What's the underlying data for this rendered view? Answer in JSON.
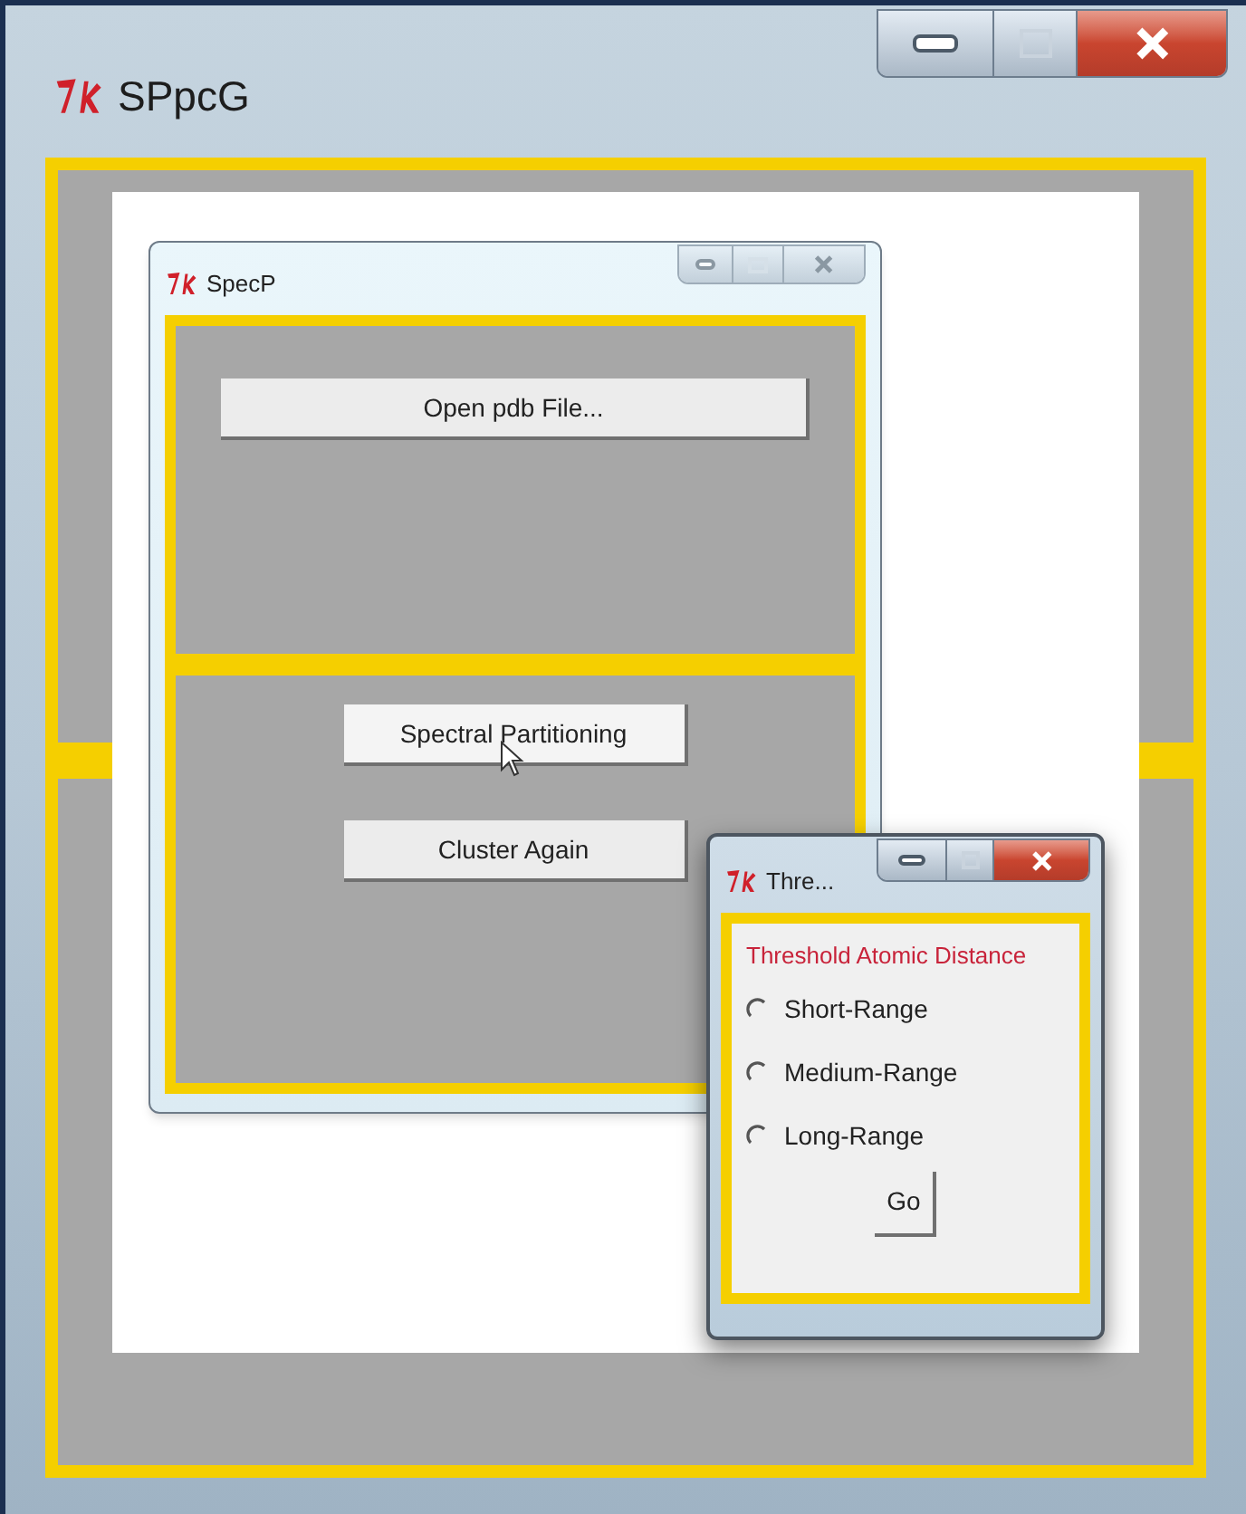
{
  "main_window": {
    "title": "SPpcG"
  },
  "specp_window": {
    "title": "SpecP",
    "buttons": [
      {
        "label": "Open pdb File...",
        "hovered": false
      },
      {
        "label": "Spectral Partitioning",
        "hovered": true
      },
      {
        "label": "Cluster Again",
        "hovered": false
      }
    ]
  },
  "threshold_window": {
    "title": "Thre...",
    "heading": "Threshold Atomic Distance",
    "options": [
      {
        "label": "Short-Range",
        "selected": false
      },
      {
        "label": "Medium-Range",
        "selected": false
      },
      {
        "label": "Long-Range",
        "selected": false
      }
    ],
    "button": "Go"
  }
}
